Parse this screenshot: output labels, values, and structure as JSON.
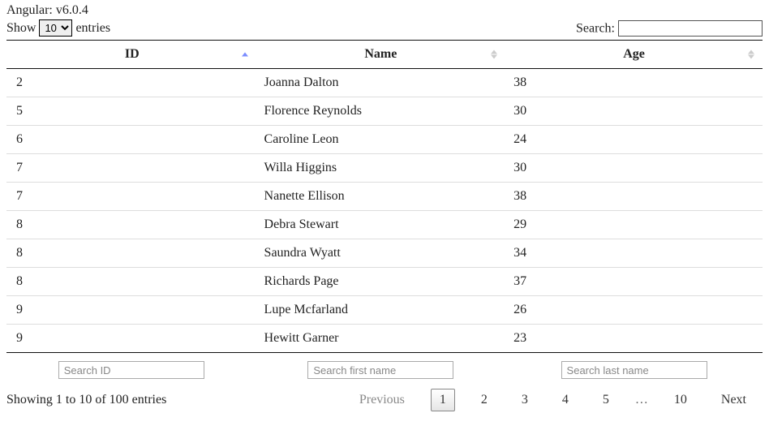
{
  "version_label": "Angular: v6.0.4",
  "length_menu": {
    "prefix": "Show",
    "suffix": "entries",
    "selected": "10"
  },
  "search": {
    "label": "Search:",
    "value": ""
  },
  "columns": [
    {
      "title": "ID",
      "sort": "asc"
    },
    {
      "title": "Name",
      "sort": "both"
    },
    {
      "title": "Age",
      "sort": "both"
    }
  ],
  "rows": [
    {
      "id": "2",
      "name": "Joanna Dalton",
      "age": "38"
    },
    {
      "id": "5",
      "name": "Florence Reynolds",
      "age": "30"
    },
    {
      "id": "6",
      "name": "Caroline Leon",
      "age": "24"
    },
    {
      "id": "7",
      "name": "Willa Higgins",
      "age": "30"
    },
    {
      "id": "7",
      "name": "Nanette Ellison",
      "age": "38"
    },
    {
      "id": "8",
      "name": "Debra Stewart",
      "age": "29"
    },
    {
      "id": "8",
      "name": "Saundra Wyatt",
      "age": "34"
    },
    {
      "id": "8",
      "name": "Richards Page",
      "age": "37"
    },
    {
      "id": "9",
      "name": "Lupe Mcfarland",
      "age": "26"
    },
    {
      "id": "9",
      "name": "Hewitt Garner",
      "age": "23"
    }
  ],
  "footer_filters": {
    "id_placeholder": "Search ID",
    "name_placeholder": "Search first name",
    "age_placeholder": "Search last name"
  },
  "info_text": "Showing 1 to 10 of 100 entries",
  "pager": {
    "previous": "Previous",
    "next": "Next",
    "pages": [
      "1",
      "2",
      "3",
      "4",
      "5"
    ],
    "ellipsis": "…",
    "last": "10",
    "current": "1"
  }
}
